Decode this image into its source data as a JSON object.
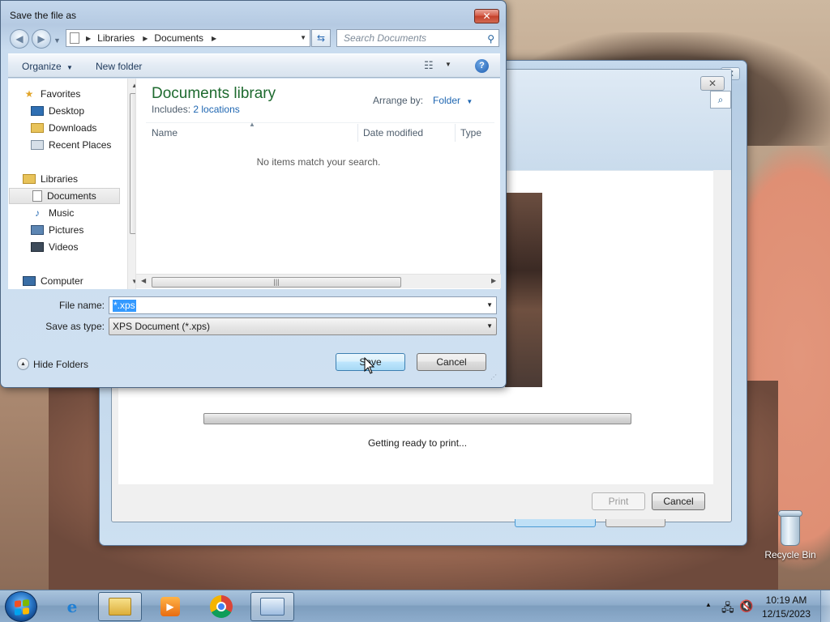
{
  "desktop": {
    "recycle_bin_label": "Recycle Bin"
  },
  "print_dialog": {
    "status_text": "Getting ready to print...",
    "print_label": "Print",
    "cancel_label": "Cancel"
  },
  "save_dialog": {
    "title": "Save the file as",
    "close_label": "✕",
    "address": {
      "segments": [
        "Libraries",
        "Documents"
      ]
    },
    "search_placeholder": "Search Documents",
    "toolbar": {
      "organize_label": "Organize",
      "new_folder_label": "New folder"
    },
    "nav": {
      "favorites": "Favorites",
      "desktop": "Desktop",
      "downloads": "Downloads",
      "recent_places": "Recent Places",
      "libraries": "Libraries",
      "documents": "Documents",
      "music": "Music",
      "pictures": "Pictures",
      "videos": "Videos",
      "computer": "Computer"
    },
    "content": {
      "library_title": "Documents library",
      "includes_label": "Includes:",
      "includes_link": "2 locations",
      "arrange_by_label": "Arrange by:",
      "arrange_by_value": "Folder",
      "columns": [
        "Name",
        "Date modified",
        "Type"
      ],
      "empty_message": "No items match your search."
    },
    "file_name_label": "File name:",
    "file_name_value": "*.xps",
    "save_as_type_label": "Save as type:",
    "save_as_type_value": "XPS Document (*.xps)",
    "hide_folders_label": "Hide Folders",
    "save_label": "Save",
    "cancel_label": "Cancel"
  },
  "taskbar": {
    "clock_time": "10:19 AM",
    "clock_date": "12/15/2023"
  },
  "colors": {
    "library_title": "#1e6a2f",
    "link": "#1e66b1",
    "selection": "#3399ff",
    "close_button": "#c3402a"
  }
}
